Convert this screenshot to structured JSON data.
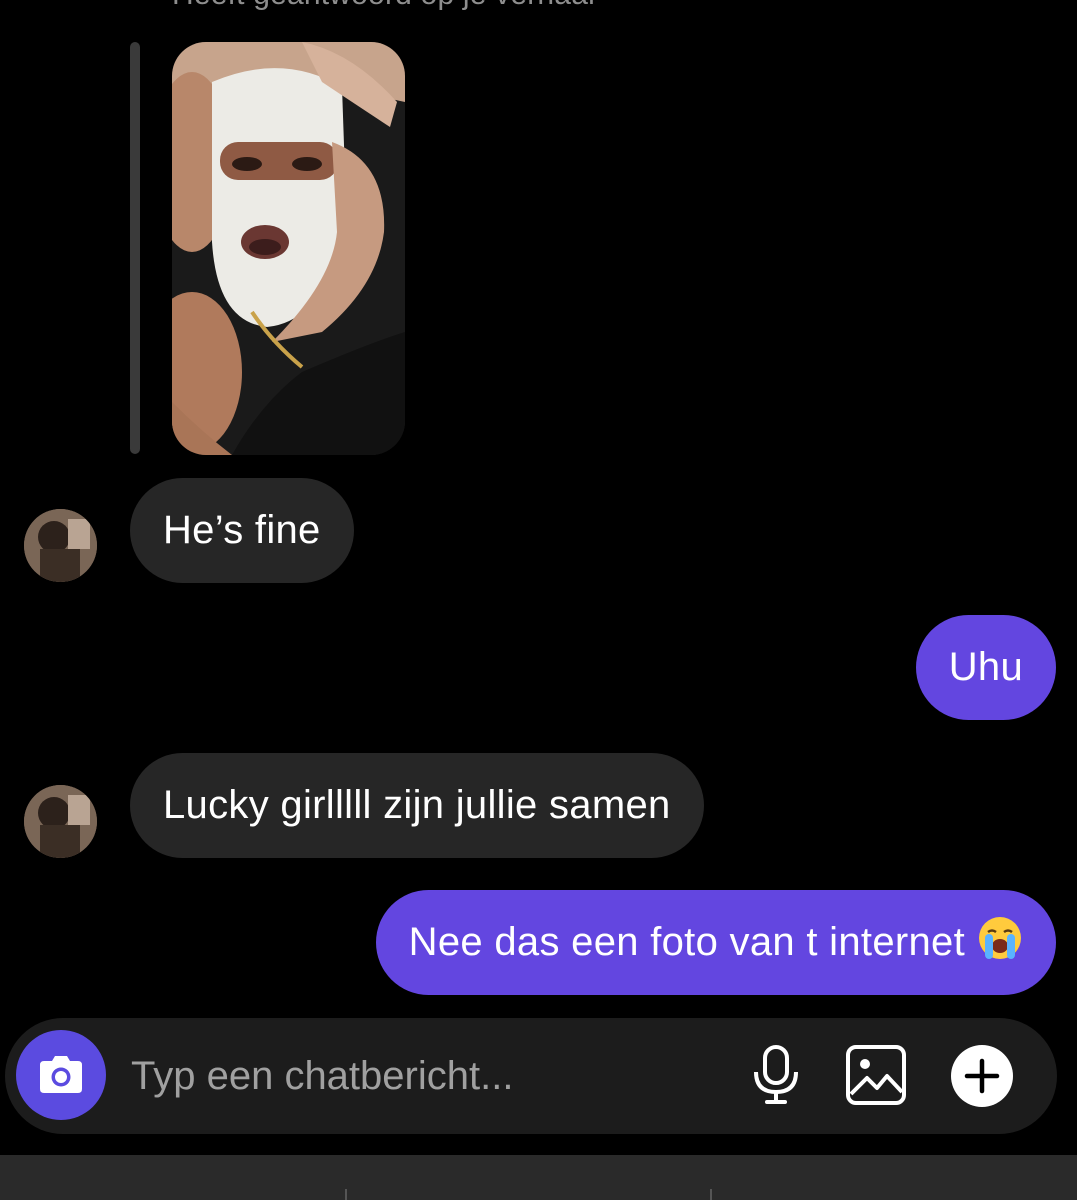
{
  "reply_header": "Heeft geantwoord op je verhaal",
  "messages": [
    {
      "direction": "incoming",
      "text": "He’s fine"
    },
    {
      "direction": "outgoing",
      "text": "Uhu"
    },
    {
      "direction": "incoming",
      "text": "Lucky girlllll zijn jullie samen"
    },
    {
      "direction": "outgoing",
      "text": "Nee das een foto van t internet",
      "emoji": "loudly-crying-face"
    }
  ],
  "composer": {
    "placeholder": "Typ een chatbericht..."
  },
  "icons": {
    "camera": "camera-icon",
    "mic": "microphone-icon",
    "gallery": "image-gallery-icon",
    "plus": "plus-circle-icon"
  },
  "colors": {
    "background": "#000000",
    "incoming_bubble": "#262626",
    "outgoing_bubble": "#6346e0",
    "camera_button": "#5b4be0",
    "composer": "#1c1c1c"
  }
}
